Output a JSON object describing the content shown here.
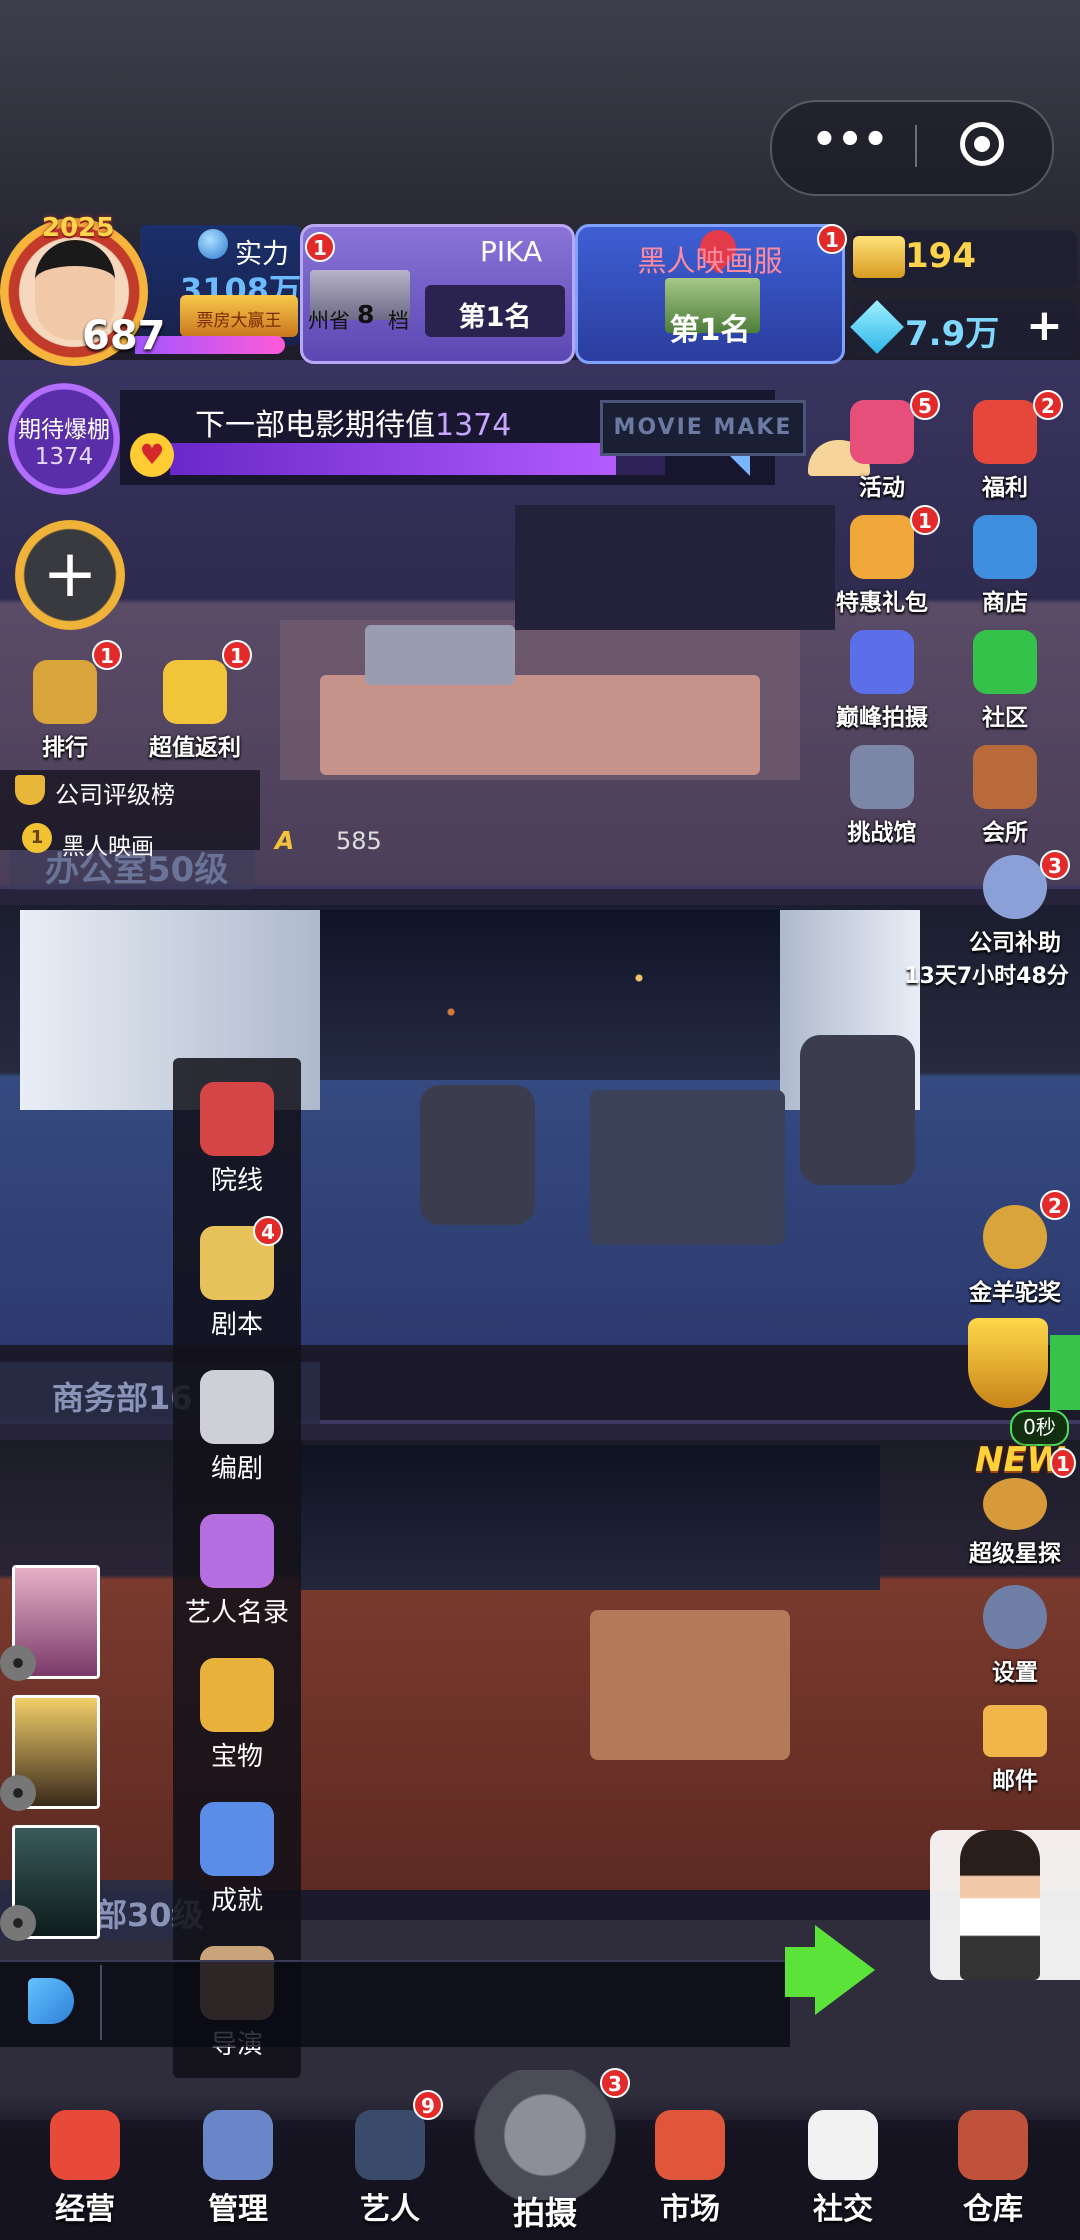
{
  "capsule": {
    "menu_dots": "•••"
  },
  "profile": {
    "year_badge": "2025",
    "level": "687",
    "power_label": "实力",
    "power_value": "3108万",
    "title_badge": "票房大赢王"
  },
  "rank_card": {
    "name": "PIKA",
    "region": "州省",
    "grade_level": "8",
    "grade_unit": "档",
    "rank": "第1名",
    "badge": "1"
  },
  "server_card": {
    "name": "黑人映画服",
    "rank": "第1名",
    "badge": "1"
  },
  "currency": {
    "tickets": "194",
    "diamonds": "7.9万",
    "add_symbol": "+"
  },
  "hype": {
    "ring_label": "期待爆棚",
    "ring_value": "1374",
    "title_prefix": "下一部电影期待值",
    "title_value": "1374",
    "progress_fraction": 0.9
  },
  "office_sign": "MOVIE MAKE",
  "right_buttons": [
    {
      "label": "活动",
      "badge": "5",
      "icon": "fireworks-icon",
      "color": "#e64f7a"
    },
    {
      "label": "福利",
      "badge": "2",
      "icon": "gift-box-icon",
      "color": "#e5483b"
    },
    {
      "label": "特惠礼包",
      "badge": "1",
      "icon": "gift-pack-icon",
      "color": "#f0a73a"
    },
    {
      "label": "商店",
      "badge": "",
      "icon": "shop-icon",
      "color": "#3f8fe0"
    },
    {
      "label": "巅峰拍摄",
      "badge": "",
      "icon": "star-emblem-icon",
      "color": "#5a6fe8"
    },
    {
      "label": "社区",
      "badge": "",
      "icon": "chat-bubble-icon",
      "color": "#35c24b"
    },
    {
      "label": "挑战馆",
      "badge": "",
      "icon": "building-icon",
      "color": "#7c86a6"
    },
    {
      "label": "会所",
      "badge": "",
      "icon": "clubhouse-icon",
      "color": "#b86a3a"
    }
  ],
  "left_buttons": [
    {
      "label": "排行",
      "badge": "1",
      "icon": "medal-icon",
      "color": "#d9a53a"
    },
    {
      "label": "超值返利",
      "badge": "1",
      "icon": "coupon-icon",
      "color": "#f2c43a"
    }
  ],
  "rating": {
    "title": "公司评级榜",
    "position": "1",
    "company": "黑人映画",
    "grade": "A",
    "score": "585",
    "office_level": "办公室50级"
  },
  "subsidy": {
    "label": "公司补助",
    "badge": "3",
    "timer": "13天7小时48分"
  },
  "golden_award": {
    "label": "金羊驼奖",
    "badge": "2"
  },
  "trophy_timer": "0秒",
  "super_scout": {
    "new_tag": "NEW",
    "label": "超级星探",
    "badge": "1"
  },
  "settings_label": "设置",
  "mail_label": "邮件",
  "management_menu": [
    {
      "label": "院线",
      "badge": "",
      "icon": "cinema-screen-icon",
      "color": "#d64545"
    },
    {
      "label": "剧本",
      "badge": "4",
      "icon": "script-icon",
      "color": "#e7c25a"
    },
    {
      "label": "编剧",
      "badge": "",
      "icon": "writer-icon",
      "color": "#cfcfd8"
    },
    {
      "label": "艺人名录",
      "badge": "",
      "icon": "directory-book-icon",
      "color": "#b46ee0"
    },
    {
      "label": "宝物",
      "badge": "",
      "icon": "magic-lamp-icon",
      "color": "#e8b23a"
    },
    {
      "label": "成就",
      "badge": "",
      "icon": "achievement-medal-icon",
      "color": "#5a8de8"
    },
    {
      "label": "导演",
      "badge": "",
      "icon": "director-vest-icon",
      "color": "#c9a47a"
    }
  ],
  "departments": {
    "business": "商务部16",
    "lower": "部30级"
  },
  "bottom_nav": [
    {
      "label": "经营",
      "badge": "",
      "icon": "popcorn-icon",
      "color": "#e84a3a"
    },
    {
      "label": "管理",
      "badge": "",
      "icon": "manage-gear-icon",
      "color": "#6a86c9"
    },
    {
      "label": "艺人",
      "badge": "9",
      "icon": "artist-icon",
      "color": "#3a4a6a"
    },
    {
      "label": "市场",
      "badge": "",
      "icon": "market-chart-icon",
      "color": "#e0563a"
    },
    {
      "label": "社交",
      "badge": "",
      "icon": "coffee-cup-icon",
      "color": "#f2f2f2"
    },
    {
      "label": "仓库",
      "badge": "",
      "icon": "warehouse-icon",
      "color": "#c0513a"
    }
  ],
  "shoot": {
    "label": "拍摄",
    "badge": "3"
  }
}
